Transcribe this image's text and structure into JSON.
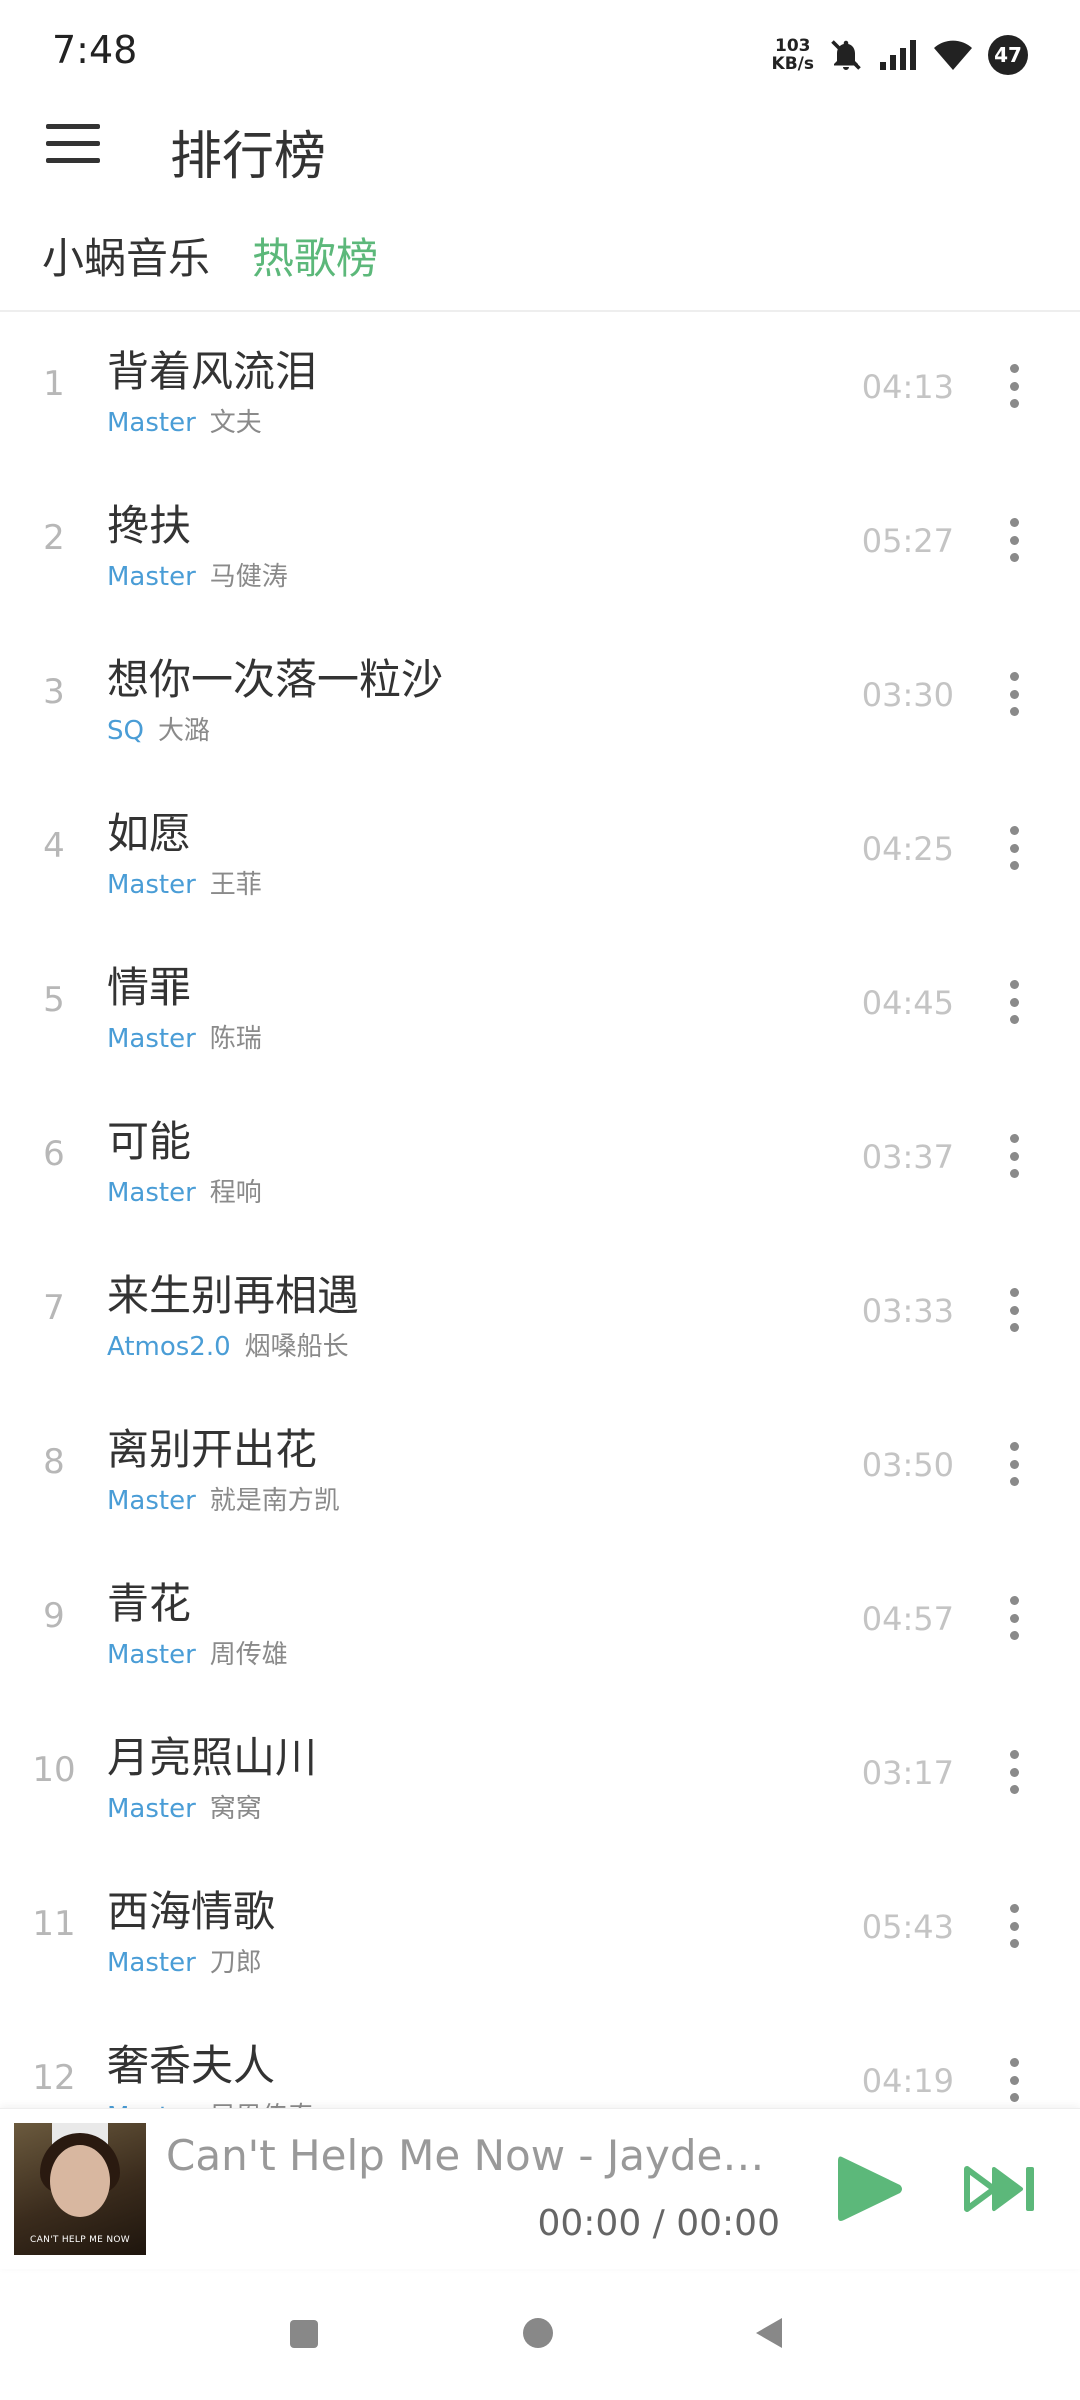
{
  "status_bar": {
    "time": "7:48",
    "net_speed_value": "103",
    "net_speed_unit": "KB/s",
    "battery": "47"
  },
  "header": {
    "title": "排行榜"
  },
  "tabs": [
    {
      "label": "小蜗音乐"
    },
    {
      "label": "热歌榜"
    }
  ],
  "colors": {
    "accent": "#5cb87a",
    "quality": "#4a9dd6"
  },
  "songs": [
    {
      "rank": "1",
      "title": "背着风流泪",
      "quality": "Master",
      "artist": "文夫",
      "duration": "04:13"
    },
    {
      "rank": "2",
      "title": "搀扶",
      "quality": "Master",
      "artist": "马健涛",
      "duration": "05:27"
    },
    {
      "rank": "3",
      "title": "想你一次落一粒沙",
      "quality": "SQ",
      "artist": "大潞",
      "duration": "03:30"
    },
    {
      "rank": "4",
      "title": "如愿",
      "quality": "Master",
      "artist": "王菲",
      "duration": "04:25"
    },
    {
      "rank": "5",
      "title": "情罪",
      "quality": "Master",
      "artist": "陈瑞",
      "duration": "04:45"
    },
    {
      "rank": "6",
      "title": "可能",
      "quality": "Master",
      "artist": "程响",
      "duration": "03:37"
    },
    {
      "rank": "7",
      "title": "来生别再相遇",
      "quality": "Atmos2.0",
      "artist": "烟嗓船长",
      "duration": "03:33"
    },
    {
      "rank": "8",
      "title": "离别开出花",
      "quality": "Master",
      "artist": "就是南方凯",
      "duration": "03:50"
    },
    {
      "rank": "9",
      "title": "青花",
      "quality": "Master",
      "artist": "周传雄",
      "duration": "04:57"
    },
    {
      "rank": "10",
      "title": "月亮照山川",
      "quality": "Master",
      "artist": "窝窝",
      "duration": "03:17"
    },
    {
      "rank": "11",
      "title": "西海情歌",
      "quality": "Master",
      "artist": "刀郎",
      "duration": "05:43"
    },
    {
      "rank": "12",
      "title": "奢香夫人",
      "quality": "Master",
      "artist": "凤凰传奇",
      "duration": "04:19"
    }
  ],
  "player": {
    "now_playing": "Can't Help Me Now - Jayden...",
    "time": "00:00 / 00:00",
    "cover_text": "CAN'T HELP ME NOW"
  }
}
